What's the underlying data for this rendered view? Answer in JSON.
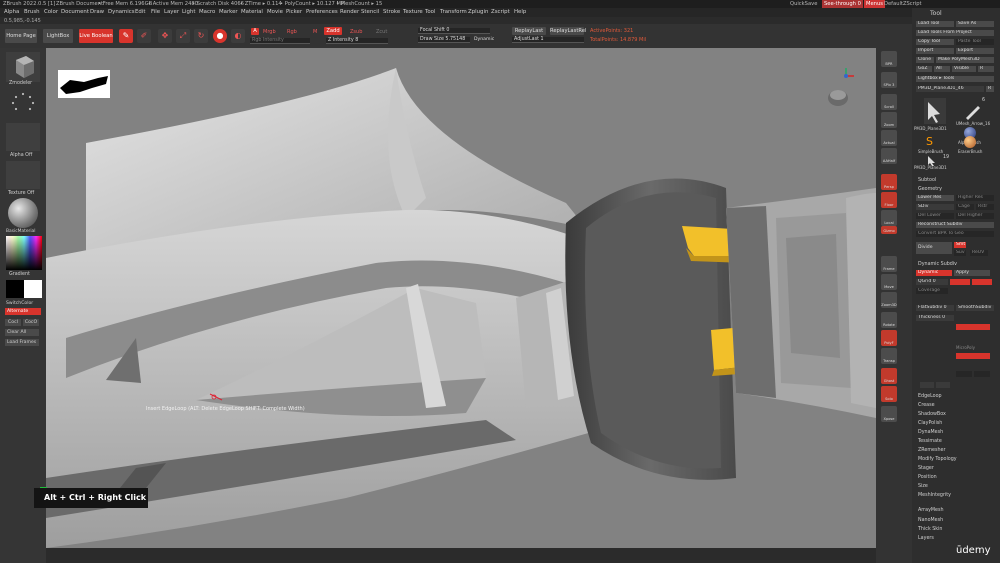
{
  "titlebar": {
    "app": "ZBrush 2022.0.5 [1]",
    "document": "ZBrush Document",
    "free_mem": "• Free Mem 6.196GB",
    "active_mem": "• Active Mem 2480",
    "scratch_disk": "• Scratch Disk 4066",
    "ztime": "• ZTime ▸ 0.114",
    "poly_count": "• PolyCount ▸ 10.127 MP",
    "mesh_count": "• MeshCount ▸ 15",
    "quicksave": "QuickSave",
    "see_through": "See-through 0",
    "menus": "Menus",
    "default_zscript": "DefaultZScript"
  },
  "menubar": [
    "Alpha",
    "Brush",
    "Color",
    "Document",
    "Draw",
    "Dynamics",
    "Edit",
    "File",
    "Layer",
    "Light",
    "Macro",
    "Marker",
    "Material",
    "Movie",
    "Picker",
    "Preferences",
    "Render",
    "Stencil",
    "Stroke",
    "Texture",
    "Tool",
    "Transform",
    "Zplugin",
    "Zscript",
    "Help"
  ],
  "coords": "0.5,985,-0.145",
  "toolbar": {
    "home_page": "Home Page",
    "lightbox": "LightBox",
    "live_boolean": "Live Boolean",
    "edit": "Edit",
    "draw": "Draw",
    "move": "Move",
    "scale": "Scale",
    "rotate": "Rotate",
    "mrgb": "Mrgb",
    "rgb": "Rgb",
    "m": "M",
    "zadd": "Zadd",
    "zsub": "Zsub",
    "zcut": "Zcut",
    "rgb_intensity": "Rgb Intensity",
    "z_intensity": "Z Intensity 8",
    "focal_shift": "Focal Shift 0",
    "draw_size": "Draw Size 5.75148",
    "dynamic": "Dynamic",
    "replay_last": "ReplayLast",
    "replay_last_rel": "ReplayLastRel",
    "adjust_last": "AdjustLast 1",
    "active_points": "ActivePoints: 321",
    "total_points": "TotalPoints: 14.879 Mil"
  },
  "left_panel": {
    "brush_label": "Zmodeler",
    "alpha_label": "Alpha Off",
    "texture_label": "Texture Off",
    "material_label": "BasicMaterial",
    "gradient": "Gradient",
    "switch_color": "SwitchColor",
    "alternate": "Alternate",
    "cocl": "CocI",
    "coco": "CocO",
    "clear_all": "Clear All",
    "load_frames": "Load Frames"
  },
  "right_shelf": [
    "BPR",
    "SPix 3",
    "Scroll",
    "Zoom",
    "Actual",
    "AAHalf",
    "Persp",
    "Floor",
    "Local",
    "Gizmo",
    "Frame",
    "Move",
    "Zoom3D",
    "Rotate",
    "PolyF",
    "Transp",
    "Ghost",
    "Solo",
    "Xpose"
  ],
  "tool_panel": {
    "title": "Tool",
    "load_tool": "Load Tool",
    "save_as": "Save As",
    "load_tools_from_project": "Load Tools From Project",
    "copy_tool": "Copy Tool",
    "paste_tool": "Paste Tool",
    "import": "Import",
    "export": "Export",
    "clone": "Clone",
    "make_polymesh": "Make PolyMesh3D",
    "goz": "GoZ",
    "all": "All",
    "visible": "Visible",
    "r": "R",
    "lightbox_tools": "Lightbox ▸ Tools",
    "current_tool": "PM3D_Plane3D1_46",
    "thumbs": [
      "PM3D_Plane3D1",
      "UMesh_Arrow_16",
      "AlphaBrush",
      "SimpleBrush",
      "EraserBrush",
      "PM3D_Plane3D1"
    ],
    "thumb_counts": [
      "6",
      "19"
    ],
    "subtool": "Subtool",
    "geometry": "Geometry",
    "lower_res": "Lower Res",
    "higher_res": "Higher Res",
    "sdiv": "SDiv",
    "cage": "Cage",
    "rstr": "Rstr",
    "del_lower": "Del Lower",
    "del_higher": "Del Higher",
    "reconstruct_subdiv": "Reconstruct Subdiv",
    "convert_bpr": "Convert BPR To Geo",
    "divide": "Divide",
    "smt": "Smt",
    "suv": "Suv",
    "reuv": "ReUV",
    "dynamic_subdiv": "Dynamic Subdiv",
    "dynamic": "Dynamic",
    "apply": "Apply",
    "qgrid": "QGrid 0",
    "coverage": "Coverage",
    "flat_subdiv": "FlatSubdiv 0",
    "smooth_subdiv": "SmoothSubdiv",
    "thickness": "Thickness 0",
    "micro_poly": "MicroPoly",
    "edge_loop": "EdgeLoop",
    "crease": "Crease",
    "shadowbox": "ShadowBox",
    "clay_polish": "ClayPolish",
    "dynamesh": "DynaMesh",
    "tessimate": "Tessimate",
    "zremesher": "ZRemesher",
    "modify_topology": "Modify Topology",
    "stager": "Stager",
    "position": "Position",
    "size": "Size",
    "mesh_integrity": "MeshIntegrity",
    "array_mesh": "ArrayMesh",
    "nano_mesh": "NanoMesh",
    "thick_skin": "Thick Skin",
    "layers": "Layers"
  },
  "viewport": {
    "tooltip": "Insert EdgeLoop (ALT: Delete EdgeLoop SHIFT: Complete Width)",
    "hint": "Alt + Ctrl + Right Click",
    "colors": {
      "background": "#828282",
      "blade": "#c4c4c4",
      "collar": "#5a5a5a",
      "accent_yellow": "#f2c02a"
    }
  },
  "branding": "ūdemy"
}
